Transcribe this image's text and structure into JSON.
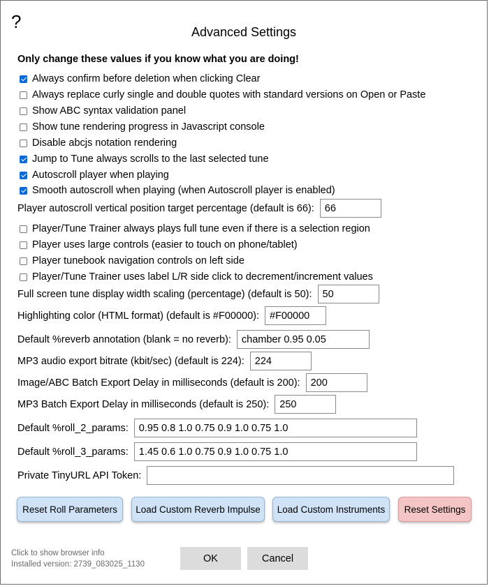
{
  "dialog": {
    "help_symbol": "?",
    "title": "Advanced Settings",
    "warning": "Only change these values if you know what you are doing!"
  },
  "checkboxes": [
    {
      "label": "Always confirm before deletion when clicking Clear",
      "checked": true
    },
    {
      "label": "Always replace curly single and double quotes with standard versions on Open or Paste",
      "checked": false
    },
    {
      "label": "Show ABC syntax validation panel",
      "checked": false
    },
    {
      "label": "Show tune rendering progress in Javascript console",
      "checked": false
    },
    {
      "label": "Disable abcjs notation rendering",
      "checked": false
    },
    {
      "label": "Jump to Tune always scrolls to the last selected tune",
      "checked": true
    },
    {
      "label": "Autoscroll player when playing",
      "checked": true
    },
    {
      "label": "Smooth autoscroll when playing (when Autoscroll player is enabled)",
      "checked": true
    }
  ],
  "autoscroll_target": {
    "label": "Player autoscroll vertical position target percentage (default is 66):",
    "value": "66"
  },
  "checkboxes2": [
    {
      "label": "Player/Tune Trainer always plays full tune even if there is a selection region",
      "checked": false
    },
    {
      "label": "Player uses large controls (easier to touch on phone/tablet)",
      "checked": false
    },
    {
      "label": "Player tunebook navigation controls on left side",
      "checked": false
    },
    {
      "label": "Player/Tune Trainer uses label L/R side click to decrement/increment values",
      "checked": false
    }
  ],
  "fields": {
    "fullscreen_width": {
      "label": "Full screen tune display width scaling (percentage) (default is 50):",
      "value": "50"
    },
    "highlight_color": {
      "label": "Highlighting color (HTML format) (default is #F00000):",
      "value": "#F00000"
    },
    "reverb": {
      "label": "Default %reverb annotation (blank = no reverb):",
      "value": "chamber 0.95 0.05"
    },
    "mp3_bitrate": {
      "label": "MP3 audio export bitrate (kbit/sec) (default is 224):",
      "value": "224"
    },
    "batch_delay": {
      "label": "Image/ABC Batch Export Delay in milliseconds (default is 200):",
      "value": "200"
    },
    "mp3_batch_delay": {
      "label": "MP3 Batch Export Delay in milliseconds (default is 250):",
      "value": "250"
    },
    "roll2": {
      "label": "Default %roll_2_params:",
      "value": "0.95 0.8 1.0 0.75 0.9 1.0 0.75 1.0"
    },
    "roll3": {
      "label": "Default %roll_3_params:",
      "value": "1.45 0.6 1.0 0.75 0.9 1.0 0.75 1.0"
    },
    "tinyurl": {
      "label": "Private TinyURL API Token:",
      "value": ""
    }
  },
  "buttons": {
    "reset_roll": "Reset Roll Parameters",
    "load_reverb": "Load Custom Reverb Impulse",
    "load_instruments": "Load Custom Instruments",
    "reset_settings": "Reset Settings",
    "ok": "OK",
    "cancel": "Cancel"
  },
  "footer": {
    "browser_info": "Click to show browser info",
    "installed_version": "Installed version: 2739_083025_1130"
  },
  "colors": {
    "button_blue": "#cfe2f6",
    "button_red": "#f5c4c4",
    "button_gray": "#dcdcdc",
    "checkbox_checked": "#0a68d8"
  }
}
